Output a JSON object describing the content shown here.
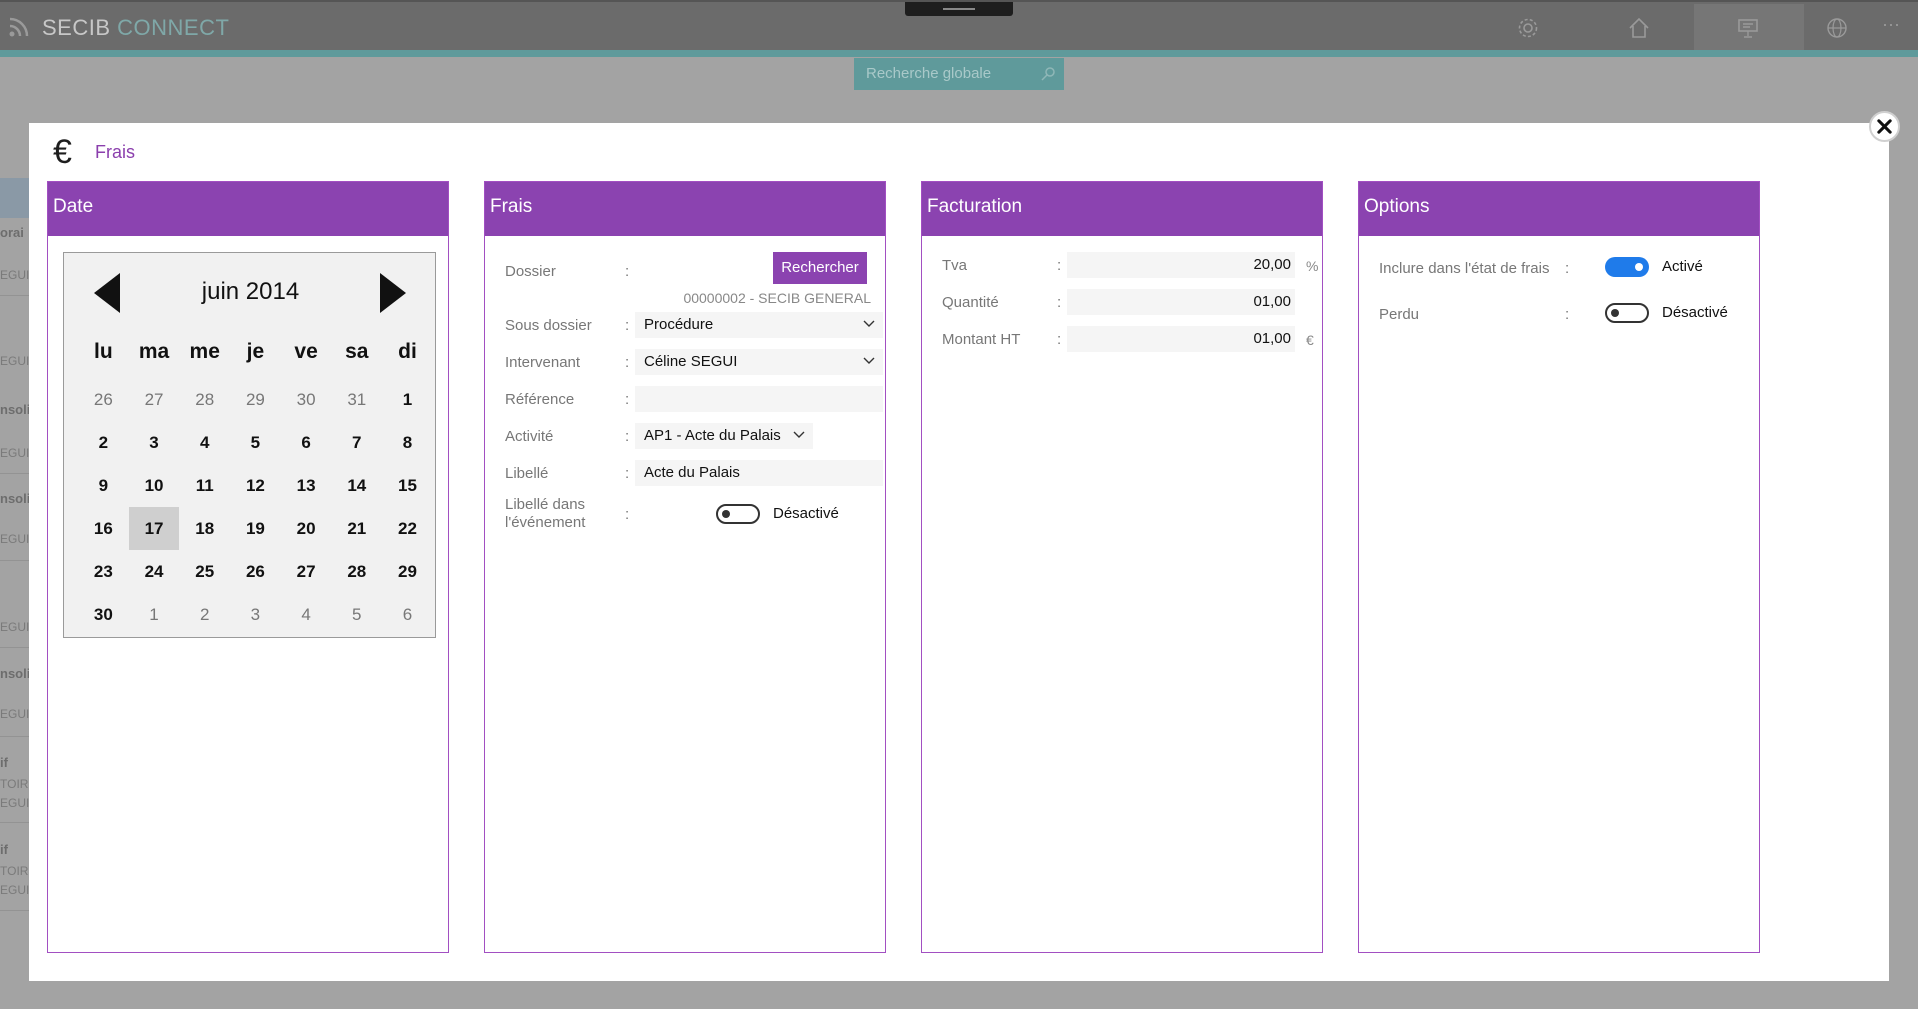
{
  "app": {
    "title_part1": "SECIB",
    "title_part2": "CONNECT",
    "search_placeholder": "Recherche globale",
    "icons": [
      "rss-icon",
      "gear-icon",
      "home-icon",
      "presentation-icon",
      "globe-icon",
      "more-icon"
    ],
    "more_label": "···"
  },
  "background_rows": [
    {
      "title": "orai",
      "sub": "EGUI"
    },
    {
      "title": "",
      "sub": "EGUI"
    },
    {
      "title": "nsoli",
      "sub": "EGUI"
    },
    {
      "title": "nsoli",
      "sub": "EGUI"
    },
    {
      "title": "",
      "sub": "EGUI"
    },
    {
      "title": "nsoli",
      "sub": "EGUI"
    },
    {
      "title": "if",
      "sub": "TOIR"
    },
    {
      "title": "",
      "sub": "EGUI"
    },
    {
      "title": "if",
      "sub": "TOIR"
    },
    {
      "title": "",
      "sub": "EGUI"
    }
  ],
  "modal": {
    "title": "Frais",
    "icon": "euro-icon"
  },
  "date_panel": {
    "title": "Date",
    "month_label": "juin 2014",
    "weekdays": [
      "lu",
      "ma",
      "me",
      "je",
      "ve",
      "sa",
      "di"
    ],
    "weeks": [
      [
        {
          "d": "26",
          "dim": true
        },
        {
          "d": "27",
          "dim": true
        },
        {
          "d": "28",
          "dim": true
        },
        {
          "d": "29",
          "dim": true
        },
        {
          "d": "30",
          "dim": true
        },
        {
          "d": "31",
          "dim": true
        },
        {
          "d": "1"
        }
      ],
      [
        {
          "d": "2"
        },
        {
          "d": "3"
        },
        {
          "d": "4"
        },
        {
          "d": "5"
        },
        {
          "d": "6"
        },
        {
          "d": "7"
        },
        {
          "d": "8"
        }
      ],
      [
        {
          "d": "9"
        },
        {
          "d": "10"
        },
        {
          "d": "11"
        },
        {
          "d": "12"
        },
        {
          "d": "13"
        },
        {
          "d": "14"
        },
        {
          "d": "15"
        }
      ],
      [
        {
          "d": "16"
        },
        {
          "d": "17",
          "sel": true
        },
        {
          "d": "18"
        },
        {
          "d": "19"
        },
        {
          "d": "20"
        },
        {
          "d": "21"
        },
        {
          "d": "22"
        }
      ],
      [
        {
          "d": "23"
        },
        {
          "d": "24"
        },
        {
          "d": "25"
        },
        {
          "d": "26"
        },
        {
          "d": "27"
        },
        {
          "d": "28"
        },
        {
          "d": "29"
        }
      ],
      [
        {
          "d": "30"
        },
        {
          "d": "1",
          "dim": true
        },
        {
          "d": "2",
          "dim": true
        },
        {
          "d": "3",
          "dim": true
        },
        {
          "d": "4",
          "dim": true
        },
        {
          "d": "5",
          "dim": true
        },
        {
          "d": "6",
          "dim": true
        }
      ]
    ]
  },
  "frais_panel": {
    "title": "Frais",
    "colon": ":",
    "dossier_label": "Dossier",
    "search_button": "Rechercher",
    "dossier_value": "00000002 - SECIB GENERAL",
    "sous_dossier_label": "Sous dossier",
    "sous_dossier_value": "Procédure",
    "intervenant_label": "Intervenant",
    "intervenant_value": "Céline SEGUI",
    "reference_label": "Référence",
    "reference_value": "",
    "activite_label": "Activité",
    "activite_value": "AP1  - Acte du Palais",
    "libelle_label": "Libellé",
    "libelle_value": "Acte du Palais",
    "libelle_event_label_1": "Libellé dans",
    "libelle_event_label_2": "l'événement",
    "libelle_event_state": "Désactivé",
    "libelle_event_on": false
  },
  "facturation_panel": {
    "title": "Facturation",
    "colon": ":",
    "tva_label": "Tva",
    "tva_value": "20,00",
    "tva_unit": "%",
    "quantite_label": "Quantité",
    "quantite_value": "01,00",
    "montant_label": "Montant HT",
    "montant_value": "01,00",
    "montant_unit": "€"
  },
  "options_panel": {
    "title": "Options",
    "colon": ":",
    "inclure_label": "Inclure dans l'état de frais",
    "inclure_state": "Activé",
    "inclure_on": true,
    "perdu_label": "Perdu",
    "perdu_state": "Désactivé",
    "perdu_on": false
  },
  "colors": {
    "accent_purple": "#8b43b0",
    "toggle_on": "#1f7bea",
    "teal": "#5f9a9b"
  }
}
